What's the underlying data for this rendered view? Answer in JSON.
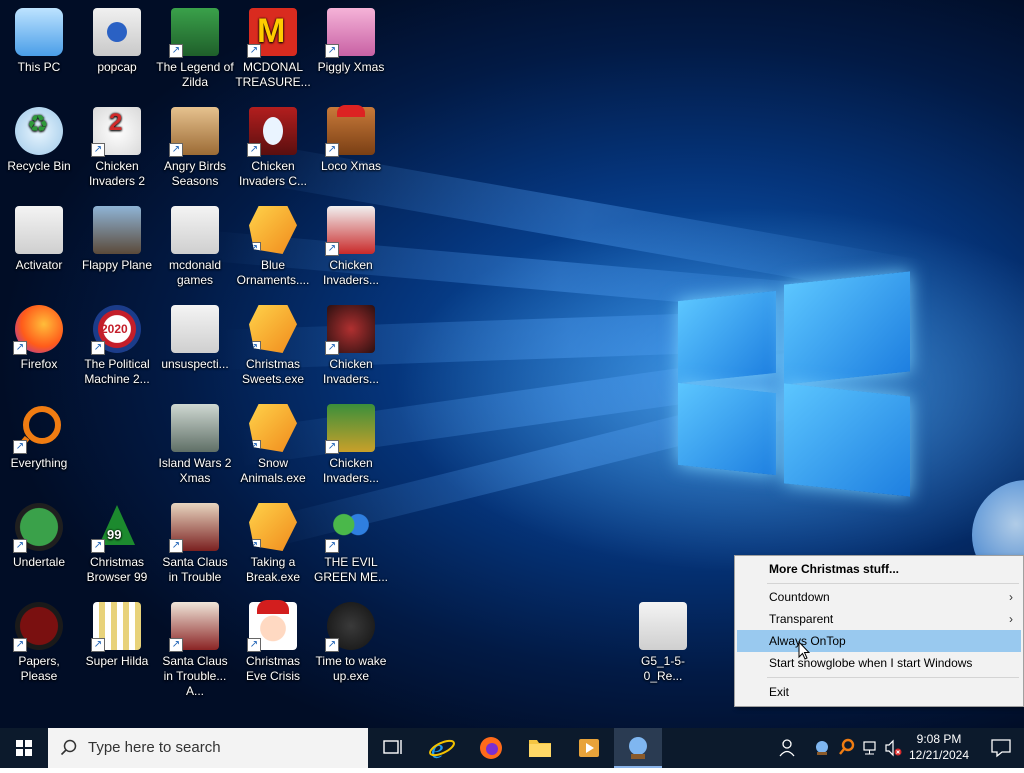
{
  "desktop": {
    "icons": [
      {
        "label": "This PC"
      },
      {
        "label": "popcap"
      },
      {
        "label": "The Legend of Zilda"
      },
      {
        "label": "MCDONAL TREASURE..."
      },
      {
        "label": "Piggly Xmas"
      },
      {
        "label": "Recycle Bin"
      },
      {
        "label": "Chicken Invaders 2"
      },
      {
        "label": "Angry Birds Seasons"
      },
      {
        "label": "Chicken Invaders C..."
      },
      {
        "label": "Loco Xmas"
      },
      {
        "label": "Activator"
      },
      {
        "label": "Flappy Plane"
      },
      {
        "label": "mcdonald games"
      },
      {
        "label": "Blue Ornaments...."
      },
      {
        "label": "Chicken Invaders..."
      },
      {
        "label": "Firefox"
      },
      {
        "label": "The Political Machine 2..."
      },
      {
        "label": "unsuspecti..."
      },
      {
        "label": "Christmas Sweets.exe"
      },
      {
        "label": "Chicken Invaders..."
      },
      {
        "label": "Everything"
      },
      {
        "label": "Island Wars 2 Xmas"
      },
      {
        "label": "Snow Animals.exe"
      },
      {
        "label": "Chicken Invaders..."
      },
      {
        "label": "Undertale"
      },
      {
        "label": "Christmas Browser 99"
      },
      {
        "label": "Santa Claus in Trouble"
      },
      {
        "label": "Taking a Break.exe"
      },
      {
        "label": "THE EVIL GREEN ME..."
      },
      {
        "label": "Papers, Please"
      },
      {
        "label": "Super Hilda"
      },
      {
        "label": "Santa Claus in Trouble... A..."
      },
      {
        "label": "Christmas Eve Crisis"
      },
      {
        "label": "Time to wake up.exe"
      },
      {
        "label": "G5_1-5-0_Re..."
      }
    ]
  },
  "context_menu": {
    "items": [
      {
        "label": "More Christmas stuff..."
      },
      {
        "label": "Countdown"
      },
      {
        "label": "Transparent"
      },
      {
        "label": "Always OnTop"
      },
      {
        "label": "Start snowglobe when I start Windows"
      },
      {
        "label": "Exit"
      }
    ],
    "submenu_arrow": "›"
  },
  "taskbar": {
    "search_placeholder": "Type here to search",
    "clock_time": "9:08 PM",
    "clock_date": "12/21/2024"
  },
  "colors": {
    "taskbar": "#0c1a2c",
    "menu_highlight": "#99c9ef",
    "menu_bg": "#f2f2f2"
  }
}
